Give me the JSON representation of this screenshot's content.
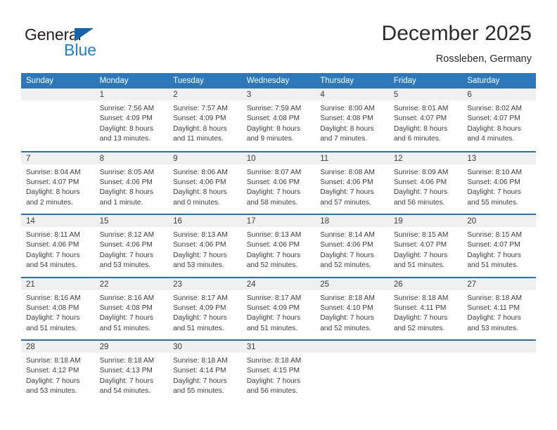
{
  "brand": {
    "name_top": "General",
    "name_bottom": "Blue",
    "triangle_color": "#1565a8",
    "blue_color": "#1b7fd4"
  },
  "header": {
    "title": "December 2025",
    "subtitle": "Rossleben, Germany",
    "header_bg": "#2c78b8",
    "week_divider_color": "#2c6fae",
    "daynum_band_bg": "#f0f0f0"
  },
  "weekday_headers": [
    "Sunday",
    "Monday",
    "Tuesday",
    "Wednesday",
    "Thursday",
    "Friday",
    "Saturday"
  ],
  "weeks": [
    [
      {
        "day": "",
        "lines": [
          "",
          "",
          "",
          ""
        ]
      },
      {
        "day": "1",
        "lines": [
          "Sunrise: 7:56 AM",
          "Sunset: 4:09 PM",
          "Daylight: 8 hours",
          "and 13 minutes."
        ]
      },
      {
        "day": "2",
        "lines": [
          "Sunrise: 7:57 AM",
          "Sunset: 4:09 PM",
          "Daylight: 8 hours",
          "and 11 minutes."
        ]
      },
      {
        "day": "3",
        "lines": [
          "Sunrise: 7:59 AM",
          "Sunset: 4:08 PM",
          "Daylight: 8 hours",
          "and 9 minutes."
        ]
      },
      {
        "day": "4",
        "lines": [
          "Sunrise: 8:00 AM",
          "Sunset: 4:08 PM",
          "Daylight: 8 hours",
          "and 7 minutes."
        ]
      },
      {
        "day": "5",
        "lines": [
          "Sunrise: 8:01 AM",
          "Sunset: 4:07 PM",
          "Daylight: 8 hours",
          "and 6 minutes."
        ]
      },
      {
        "day": "6",
        "lines": [
          "Sunrise: 8:02 AM",
          "Sunset: 4:07 PM",
          "Daylight: 8 hours",
          "and 4 minutes."
        ]
      }
    ],
    [
      {
        "day": "7",
        "lines": [
          "Sunrise: 8:04 AM",
          "Sunset: 4:07 PM",
          "Daylight: 8 hours",
          "and 2 minutes."
        ]
      },
      {
        "day": "8",
        "lines": [
          "Sunrise: 8:05 AM",
          "Sunset: 4:06 PM",
          "Daylight: 8 hours",
          "and 1 minute."
        ]
      },
      {
        "day": "9",
        "lines": [
          "Sunrise: 8:06 AM",
          "Sunset: 4:06 PM",
          "Daylight: 8 hours",
          "and 0 minutes."
        ]
      },
      {
        "day": "10",
        "lines": [
          "Sunrise: 8:07 AM",
          "Sunset: 4:06 PM",
          "Daylight: 7 hours",
          "and 58 minutes."
        ]
      },
      {
        "day": "11",
        "lines": [
          "Sunrise: 8:08 AM",
          "Sunset: 4:06 PM",
          "Daylight: 7 hours",
          "and 57 minutes."
        ]
      },
      {
        "day": "12",
        "lines": [
          "Sunrise: 8:09 AM",
          "Sunset: 4:06 PM",
          "Daylight: 7 hours",
          "and 56 minutes."
        ]
      },
      {
        "day": "13",
        "lines": [
          "Sunrise: 8:10 AM",
          "Sunset: 4:06 PM",
          "Daylight: 7 hours",
          "and 55 minutes."
        ]
      }
    ],
    [
      {
        "day": "14",
        "lines": [
          "Sunrise: 8:11 AM",
          "Sunset: 4:06 PM",
          "Daylight: 7 hours",
          "and 54 minutes."
        ]
      },
      {
        "day": "15",
        "lines": [
          "Sunrise: 8:12 AM",
          "Sunset: 4:06 PM",
          "Daylight: 7 hours",
          "and 53 minutes."
        ]
      },
      {
        "day": "16",
        "lines": [
          "Sunrise: 8:13 AM",
          "Sunset: 4:06 PM",
          "Daylight: 7 hours",
          "and 53 minutes."
        ]
      },
      {
        "day": "17",
        "lines": [
          "Sunrise: 8:13 AM",
          "Sunset: 4:06 PM",
          "Daylight: 7 hours",
          "and 52 minutes."
        ]
      },
      {
        "day": "18",
        "lines": [
          "Sunrise: 8:14 AM",
          "Sunset: 4:06 PM",
          "Daylight: 7 hours",
          "and 52 minutes."
        ]
      },
      {
        "day": "19",
        "lines": [
          "Sunrise: 8:15 AM",
          "Sunset: 4:07 PM",
          "Daylight: 7 hours",
          "and 51 minutes."
        ]
      },
      {
        "day": "20",
        "lines": [
          "Sunrise: 8:15 AM",
          "Sunset: 4:07 PM",
          "Daylight: 7 hours",
          "and 51 minutes."
        ]
      }
    ],
    [
      {
        "day": "21",
        "lines": [
          "Sunrise: 8:16 AM",
          "Sunset: 4:08 PM",
          "Daylight: 7 hours",
          "and 51 minutes."
        ]
      },
      {
        "day": "22",
        "lines": [
          "Sunrise: 8:16 AM",
          "Sunset: 4:08 PM",
          "Daylight: 7 hours",
          "and 51 minutes."
        ]
      },
      {
        "day": "23",
        "lines": [
          "Sunrise: 8:17 AM",
          "Sunset: 4:09 PM",
          "Daylight: 7 hours",
          "and 51 minutes."
        ]
      },
      {
        "day": "24",
        "lines": [
          "Sunrise: 8:17 AM",
          "Sunset: 4:09 PM",
          "Daylight: 7 hours",
          "and 51 minutes."
        ]
      },
      {
        "day": "25",
        "lines": [
          "Sunrise: 8:18 AM",
          "Sunset: 4:10 PM",
          "Daylight: 7 hours",
          "and 52 minutes."
        ]
      },
      {
        "day": "26",
        "lines": [
          "Sunrise: 8:18 AM",
          "Sunset: 4:11 PM",
          "Daylight: 7 hours",
          "and 52 minutes."
        ]
      },
      {
        "day": "27",
        "lines": [
          "Sunrise: 8:18 AM",
          "Sunset: 4:11 PM",
          "Daylight: 7 hours",
          "and 53 minutes."
        ]
      }
    ],
    [
      {
        "day": "28",
        "lines": [
          "Sunrise: 8:18 AM",
          "Sunset: 4:12 PM",
          "Daylight: 7 hours",
          "and 53 minutes."
        ]
      },
      {
        "day": "29",
        "lines": [
          "Sunrise: 8:18 AM",
          "Sunset: 4:13 PM",
          "Daylight: 7 hours",
          "and 54 minutes."
        ]
      },
      {
        "day": "30",
        "lines": [
          "Sunrise: 8:18 AM",
          "Sunset: 4:14 PM",
          "Daylight: 7 hours",
          "and 55 minutes."
        ]
      },
      {
        "day": "31",
        "lines": [
          "Sunrise: 8:18 AM",
          "Sunset: 4:15 PM",
          "Daylight: 7 hours",
          "and 56 minutes."
        ]
      },
      {
        "day": "",
        "lines": [
          "",
          "",
          "",
          ""
        ]
      },
      {
        "day": "",
        "lines": [
          "",
          "",
          "",
          ""
        ]
      },
      {
        "day": "",
        "lines": [
          "",
          "",
          "",
          ""
        ]
      }
    ]
  ]
}
